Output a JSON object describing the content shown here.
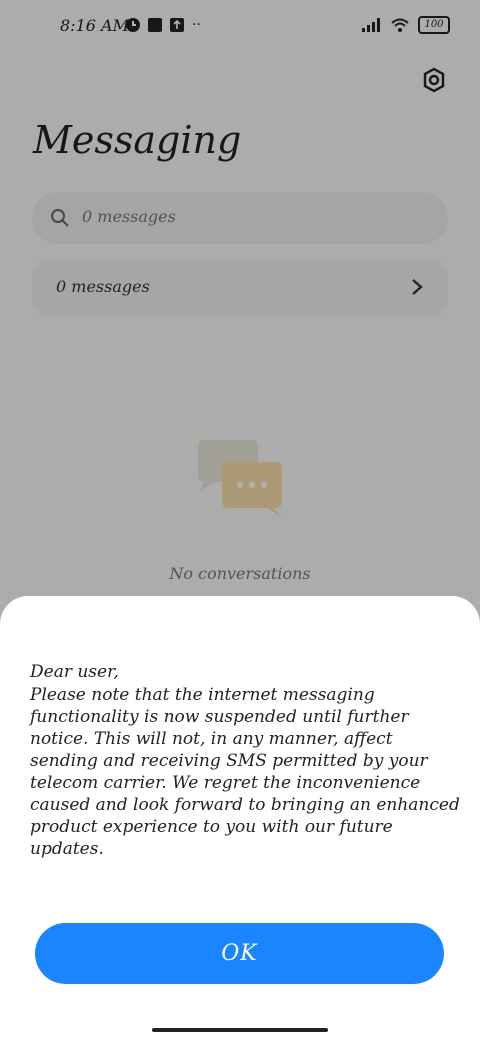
{
  "status_bar": {
    "time": "8:16 AM",
    "battery": "100"
  },
  "header": {
    "title": "Messaging"
  },
  "search": {
    "placeholder": "0 messages"
  },
  "folder": {
    "label": "0 messages"
  },
  "empty_state": {
    "text": "No conversations"
  },
  "dialog": {
    "greeting": "Dear user,",
    "body": "Please note that the internet messaging\nfunctionality is now suspended until further\nnotice. This will not, in any manner, affect\nsending and receiving SMS permitted by your\ntelecom carrier. We regret the inconvenience\ncaused and look forward to bringing an enhanced\nproduct experience to you with our future\nupdates.",
    "ok_label": "OK"
  },
  "colors": {
    "accent": "#1a85ff",
    "overlay": "rgba(0,0,0,0.30)"
  }
}
